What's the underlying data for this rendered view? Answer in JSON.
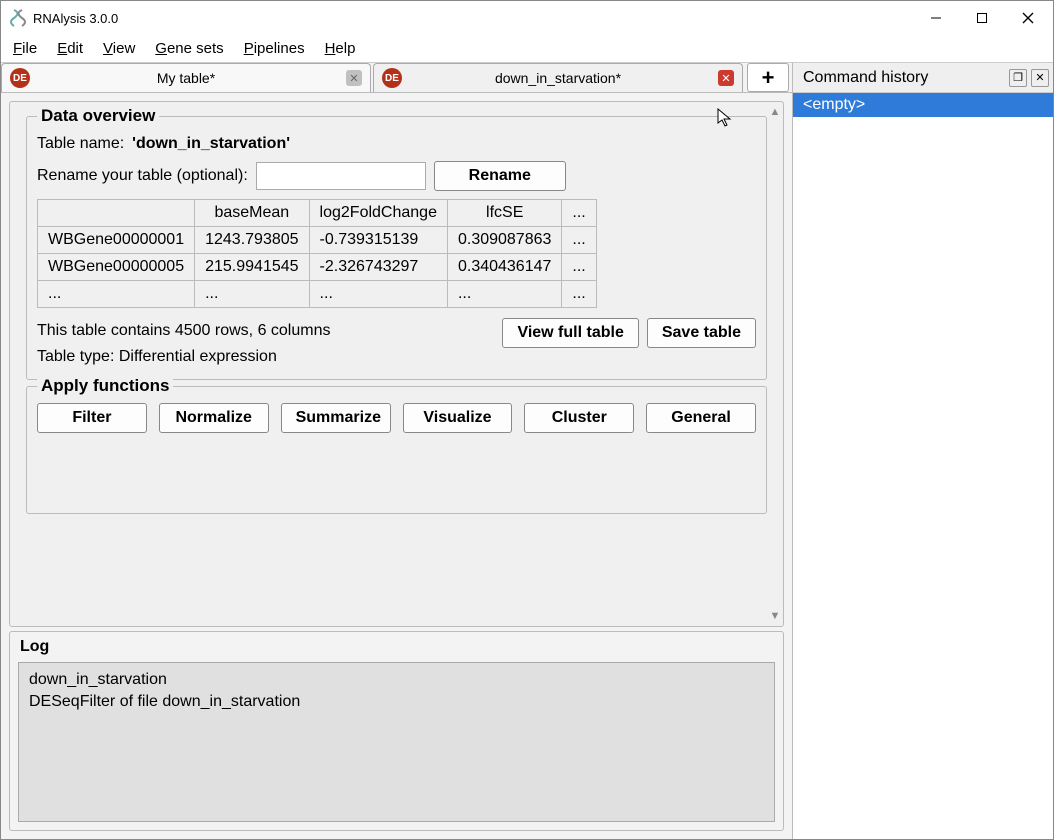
{
  "window": {
    "title": "RNAlysis 3.0.0"
  },
  "menu": {
    "file": "File",
    "edit": "Edit",
    "view": "View",
    "gene_sets": "Gene sets",
    "pipelines": "Pipelines",
    "help": "Help"
  },
  "tabs": {
    "items": [
      {
        "badge": "DE",
        "label": "My table*",
        "close_style": "gray"
      },
      {
        "badge": "DE",
        "label": "down_in_starvation*",
        "close_style": "red"
      }
    ],
    "new_label": "+"
  },
  "overview": {
    "title": "Data overview",
    "tablename_label": "Table name:",
    "tablename_value": "'down_in_starvation'",
    "rename_label": "Rename your table (optional):",
    "rename_value": "",
    "rename_button": "Rename",
    "preview": {
      "headers": [
        "",
        "baseMean",
        "log2FoldChange",
        "lfcSE",
        "..."
      ],
      "rows": [
        [
          "WBGene00000001",
          "1243.793805",
          "-0.739315139",
          "0.309087863",
          "..."
        ],
        [
          "WBGene00000005",
          "215.9941545",
          "-2.326743297",
          "0.340436147",
          "..."
        ],
        [
          "...",
          "...",
          "...",
          "...",
          "..."
        ]
      ]
    },
    "rows_info": "This table contains 4500 rows, 6 columns",
    "type_info": "Table type: Differential expression",
    "view_full": "View full table",
    "save": "Save table"
  },
  "functions": {
    "title": "Apply functions",
    "buttons": [
      "Filter",
      "Normalize",
      "Summarize",
      "Visualize",
      "Cluster",
      "General"
    ]
  },
  "log": {
    "title": "Log",
    "line1": "down_in_starvation",
    "line2": "DESeqFilter of file down_in_starvation"
  },
  "command_history": {
    "title": "Command history",
    "entry": "<empty>"
  }
}
